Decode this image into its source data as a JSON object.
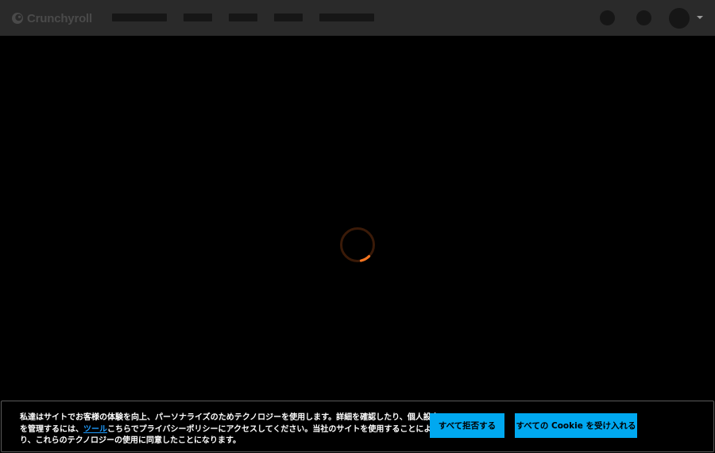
{
  "header": {
    "logo_text": "Crunchyroll",
    "colors": {
      "background": "#2a2a2a",
      "logo": "#4a4a4a",
      "placeholder": "#161616"
    },
    "icons": [
      "crunchyroll-logo-icon",
      "search-icon",
      "bookmark-icon",
      "avatar",
      "chevron-down-icon"
    ]
  },
  "main": {
    "loading_spinner": {
      "accent_color": "#f47521",
      "track_color": "#3a1a08"
    }
  },
  "cookie_banner": {
    "text_lines": [
      "私達はサイトでお客様の体験を向上、パーソナライズのためテクノロジーを使用します。詳細を確認したり、個人設定",
      "を管理するには、",
      "こちらでプライバシーポリシーにアクセスしてください。当社のサイトを使用することによ",
      "り、これらのテクノロジーの使用に同意したことになります。"
    ],
    "link_text": "ツール",
    "reject_button_label": "すべて拒否する",
    "accept_button_label": "すべての Cookie を受け入れる",
    "button_color": "#00a8f0",
    "link_color": "#1e9cff"
  }
}
